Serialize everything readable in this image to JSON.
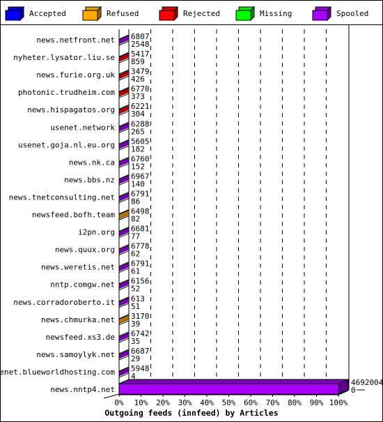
{
  "chart_data": {
    "type": "bar",
    "orientation": "horizontal",
    "style": "3d-stacked",
    "title": "",
    "xlabel": "Outgoing feeds (innfeed) by Articles",
    "ylabel": "",
    "xlim": [
      0,
      100
    ],
    "x_unit": "%",
    "x_ticks": [
      "0%",
      "10%",
      "20%",
      "30%",
      "40%",
      "50%",
      "60%",
      "70%",
      "80%",
      "90%",
      "100%"
    ],
    "grid": true,
    "legend_position": "top",
    "legend": [
      {
        "name": "Accepted",
        "color": "#0000ff"
      },
      {
        "name": "Refused",
        "color": "#ffaa00"
      },
      {
        "name": "Rejected",
        "color": "#ff0000"
      },
      {
        "name": "Missing",
        "color": "#00ff00"
      },
      {
        "name": "Spooled",
        "color": "#aa00ff"
      }
    ],
    "categories": [
      "news.netfront.net",
      "nyheter.lysator.liu.se",
      "news.furie.org.uk",
      "photonic.trudheim.com",
      "news.hispagatos.org",
      "usenet.network",
      "usenet.goja.nl.eu.org",
      "news.nk.ca",
      "news.bbs.nz",
      "news.tnetconsulting.net",
      "newsfeed.bofh.team",
      "i2pn.org",
      "news.quux.org",
      "news.weretis.net",
      "nntp.comgw.net",
      "news.corradoroberto.it",
      "news.chmurka.net",
      "newsfeed.xs3.de",
      "news.samoylyk.net",
      "usenet.blueworldhosting.com",
      "news.nntp4.net"
    ],
    "rows": [
      {
        "label_top": "6807",
        "label_bottom": "2548",
        "series": "Spooled"
      },
      {
        "label_top": "5417",
        "label_bottom": "859",
        "series": "Rejected"
      },
      {
        "label_top": "3479",
        "label_bottom": "426",
        "series": "Rejected"
      },
      {
        "label_top": "6770",
        "label_bottom": "373",
        "series": "Rejected"
      },
      {
        "label_top": "6221",
        "label_bottom": "304",
        "series": "Rejected"
      },
      {
        "label_top": "6288",
        "label_bottom": "265",
        "series": "Spooled"
      },
      {
        "label_top": "5605",
        "label_bottom": "182",
        "series": "Spooled"
      },
      {
        "label_top": "6760",
        "label_bottom": "152",
        "series": "Spooled"
      },
      {
        "label_top": "6967",
        "label_bottom": "140",
        "series": "Spooled"
      },
      {
        "label_top": "6791",
        "label_bottom": "86",
        "series": "Spooled"
      },
      {
        "label_top": "6498",
        "label_bottom": "82",
        "series": "Refused"
      },
      {
        "label_top": "6681",
        "label_bottom": "77",
        "series": "Spooled"
      },
      {
        "label_top": "6778",
        "label_bottom": "62",
        "series": "Spooled"
      },
      {
        "label_top": "6791",
        "label_bottom": "61",
        "series": "Spooled"
      },
      {
        "label_top": "6156",
        "label_bottom": "52",
        "series": "Spooled"
      },
      {
        "label_top": "613",
        "label_bottom": "51",
        "series": "Spooled"
      },
      {
        "label_top": "3170",
        "label_bottom": "39",
        "series": "Refused"
      },
      {
        "label_top": "6742",
        "label_bottom": "35",
        "series": "Spooled"
      },
      {
        "label_top": "6687",
        "label_bottom": "29",
        "series": "Spooled"
      },
      {
        "label_top": "5948",
        "label_bottom": "4",
        "series": "Spooled"
      },
      {
        "label_top": "4692004",
        "label_bottom": "0",
        "series": "Spooled",
        "percent": 100
      }
    ]
  }
}
